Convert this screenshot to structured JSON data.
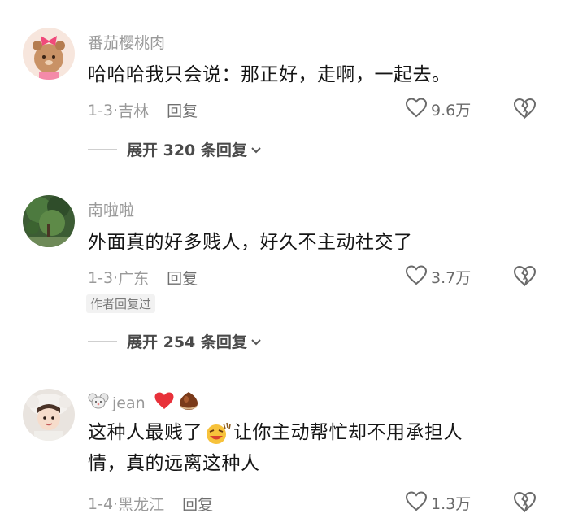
{
  "comments": [
    {
      "username": "番茄樱桃肉",
      "text": "哈哈哈我只会说：那正好，走啊，一起去。",
      "date": "1-3·",
      "location": "吉林",
      "reply_label": "回复",
      "likes": "9.6万",
      "expand_label": "展开 320 条回复"
    },
    {
      "username": "南啦啦",
      "text": "外面真的好多贱人，好久不主动社交了",
      "date": "1-3·",
      "location": "广东",
      "reply_label": "回复",
      "likes": "3.7万",
      "author_badge": "作者回复过",
      "expand_label": "展开 254 条回复"
    },
    {
      "username": "jean",
      "text_part1": "这种人最贱了",
      "text_part2": "让你主动帮忙却不用承担人",
      "text_line2": "情，真的远离这种人",
      "date": "1-4·",
      "location": "黑龙江",
      "reply_label": "回复",
      "likes": "1.3万"
    }
  ],
  "icons": {
    "like": "heart-outline-icon",
    "dislike": "broken-heart-icon",
    "expand": "chevron-down-icon"
  },
  "colors": {
    "username": "#9a9a9a",
    "text": "#151515",
    "badge_bg": "#f2f2f2",
    "heart_red": "#e8313a"
  }
}
